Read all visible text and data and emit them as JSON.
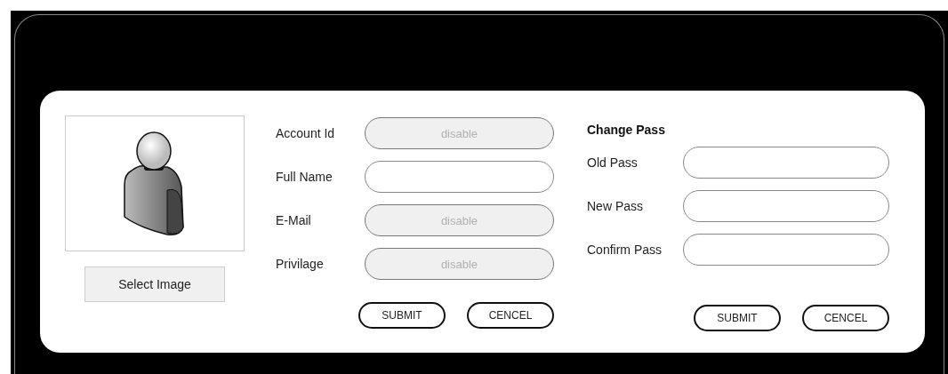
{
  "profile": {
    "select_button": "Select Image"
  },
  "account_form": {
    "fields": [
      {
        "label": "Account Id",
        "value": "disable",
        "disabled": true
      },
      {
        "label": "Full Name",
        "disabled": false
      },
      {
        "label": "E-Mail",
        "value": "disable",
        "disabled": true
      },
      {
        "label": "Privilage",
        "value": "disable",
        "disabled": true
      }
    ],
    "buttons": [
      "SUBMIT",
      "CENCEL"
    ]
  },
  "password_form": {
    "title": "Change Pass",
    "fields": [
      {
        "label": "Old Pass",
        "disabled": false
      },
      {
        "label": "New Pass",
        "disabled": false
      },
      {
        "label": "Confirm Pass",
        "disabled": false
      }
    ],
    "buttons": [
      "SUBMIT",
      "CENCEL"
    ]
  }
}
